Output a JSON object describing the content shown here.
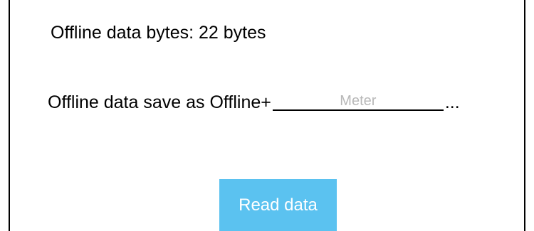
{
  "offline_bytes_label": "Offline data bytes: 22 bytes",
  "save_as": {
    "prefix": "Offline data save as Offline+",
    "filename_placeholder": "Meter",
    "filename_value": "",
    "suffix": "..."
  },
  "read_button": {
    "label": "Read data"
  },
  "colors": {
    "button_bg": "#5bc2f0",
    "button_text": "#ffffff",
    "placeholder": "#b8b8b8",
    "border": "#000000"
  }
}
